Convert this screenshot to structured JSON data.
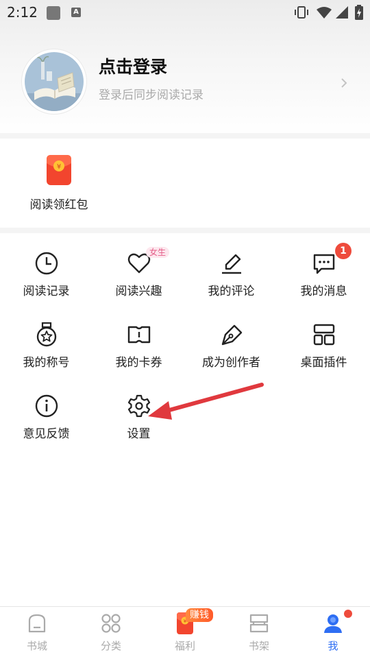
{
  "status_bar": {
    "time": "2:12",
    "notification_letter": "A"
  },
  "profile": {
    "title": "点击登录",
    "subtitle": "登录后同步阅读记录"
  },
  "red_packet": {
    "label": "阅读领红包",
    "icon": "red-packet-icon"
  },
  "grid": [
    {
      "label": "阅读记录",
      "icon": "clock-icon"
    },
    {
      "label": "阅读兴趣",
      "icon": "heart-icon",
      "tag": "女生"
    },
    {
      "label": "我的评论",
      "icon": "pencil-icon"
    },
    {
      "label": "我的消息",
      "icon": "chat-bubble-icon",
      "badge": "1"
    },
    {
      "label": "我的称号",
      "icon": "medal-icon"
    },
    {
      "label": "我的卡券",
      "icon": "coupon-icon"
    },
    {
      "label": "成为创作者",
      "icon": "pen-nib-icon"
    },
    {
      "label": "桌面插件",
      "icon": "widget-icon"
    },
    {
      "label": "意见反馈",
      "icon": "info-icon"
    },
    {
      "label": "设置",
      "icon": "gear-icon"
    }
  ],
  "bottom_nav": [
    {
      "label": "书城",
      "icon": "bookstore-icon"
    },
    {
      "label": "分类",
      "icon": "category-grid-icon"
    },
    {
      "label": "福利",
      "icon": "red-packet-icon",
      "tag": "赚钱"
    },
    {
      "label": "书架",
      "icon": "bookshelf-icon"
    },
    {
      "label": "我",
      "icon": "user-icon",
      "active": true
    }
  ],
  "colors": {
    "accent": "#2e6ef3",
    "badge": "#ee4b3c",
    "annotation_arrow": "#e0393e"
  }
}
